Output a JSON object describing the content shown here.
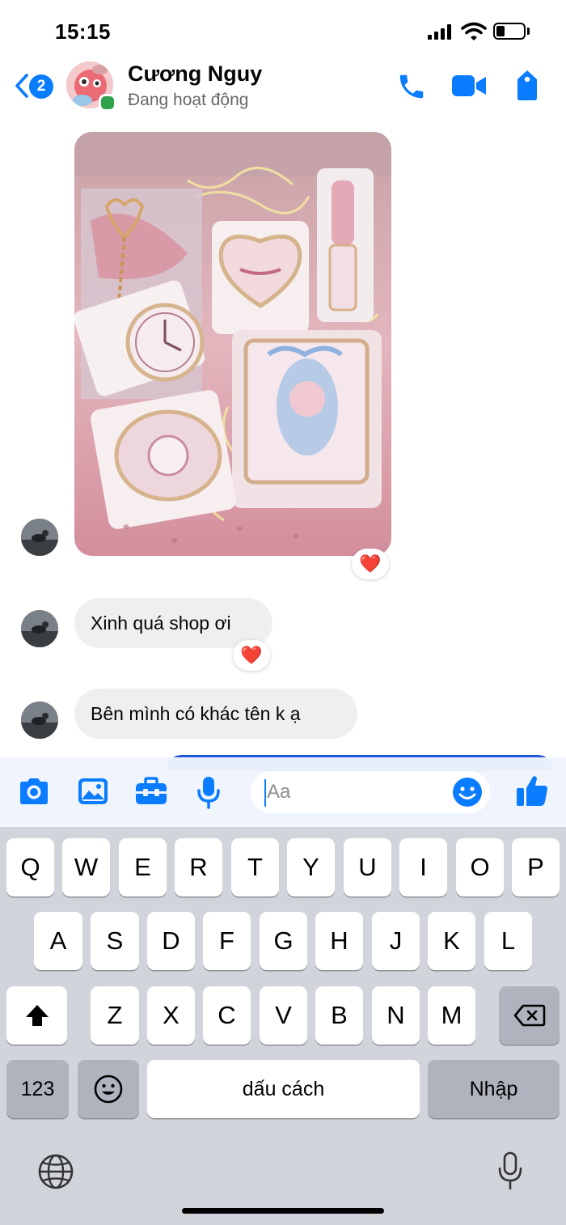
{
  "status_bar": {
    "time": "15:15",
    "battery_level": 0.3
  },
  "header": {
    "unread_count": "2",
    "contact_name": "Cương Nguy",
    "contact_status": "Đang hoạt động"
  },
  "messages": [
    {
      "type": "image",
      "sender": "contact",
      "reaction": "❤️"
    },
    {
      "type": "text",
      "sender": "contact",
      "text": "Xinh quá shop ơi",
      "reaction": "❤️"
    },
    {
      "type": "text",
      "sender": "contact",
      "text": "Bên mình có khác tên k ạ"
    }
  ],
  "composer": {
    "placeholder": "Aa",
    "value": ""
  },
  "keyboard": {
    "row1": [
      "Q",
      "W",
      "E",
      "R",
      "T",
      "Y",
      "U",
      "I",
      "O",
      "P"
    ],
    "row2": [
      "A",
      "S",
      "D",
      "F",
      "G",
      "H",
      "J",
      "K",
      "L"
    ],
    "row3": [
      "Z",
      "X",
      "C",
      "V",
      "B",
      "N",
      "M"
    ],
    "numbers_label": "123",
    "space_label": "dấu cách",
    "return_label": "Nhập"
  },
  "colors": {
    "accent": "#0a7cff",
    "bubble_incoming": "#efeff2",
    "online": "#31a24c",
    "keyboard_bg": "#d1d4db"
  },
  "icons": {
    "header": [
      "back-chevron-icon",
      "phone-icon",
      "video-icon",
      "tag-icon"
    ],
    "composer": [
      "camera-icon",
      "gallery-icon",
      "toolbox-icon",
      "microphone-icon",
      "emoji-icon",
      "thumbs-up-icon"
    ],
    "keyboard": [
      "shift-icon",
      "backspace-icon",
      "emoji-icon",
      "globe-icon",
      "dictation-icon"
    ]
  }
}
